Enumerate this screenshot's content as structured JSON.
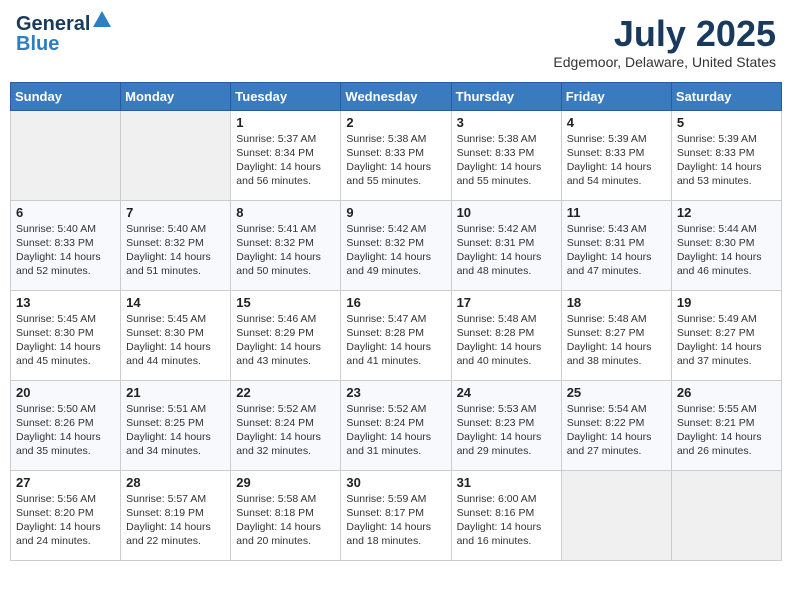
{
  "header": {
    "logo_general": "General",
    "logo_blue": "Blue",
    "title": "July 2025",
    "location": "Edgemoor, Delaware, United States"
  },
  "days_of_week": [
    "Sunday",
    "Monday",
    "Tuesday",
    "Wednesday",
    "Thursday",
    "Friday",
    "Saturday"
  ],
  "weeks": [
    [
      {
        "day": "",
        "detail": ""
      },
      {
        "day": "",
        "detail": ""
      },
      {
        "day": "1",
        "detail": "Sunrise: 5:37 AM\nSunset: 8:34 PM\nDaylight: 14 hours and 56 minutes."
      },
      {
        "day": "2",
        "detail": "Sunrise: 5:38 AM\nSunset: 8:33 PM\nDaylight: 14 hours and 55 minutes."
      },
      {
        "day": "3",
        "detail": "Sunrise: 5:38 AM\nSunset: 8:33 PM\nDaylight: 14 hours and 55 minutes."
      },
      {
        "day": "4",
        "detail": "Sunrise: 5:39 AM\nSunset: 8:33 PM\nDaylight: 14 hours and 54 minutes."
      },
      {
        "day": "5",
        "detail": "Sunrise: 5:39 AM\nSunset: 8:33 PM\nDaylight: 14 hours and 53 minutes."
      }
    ],
    [
      {
        "day": "6",
        "detail": "Sunrise: 5:40 AM\nSunset: 8:33 PM\nDaylight: 14 hours and 52 minutes."
      },
      {
        "day": "7",
        "detail": "Sunrise: 5:40 AM\nSunset: 8:32 PM\nDaylight: 14 hours and 51 minutes."
      },
      {
        "day": "8",
        "detail": "Sunrise: 5:41 AM\nSunset: 8:32 PM\nDaylight: 14 hours and 50 minutes."
      },
      {
        "day": "9",
        "detail": "Sunrise: 5:42 AM\nSunset: 8:32 PM\nDaylight: 14 hours and 49 minutes."
      },
      {
        "day": "10",
        "detail": "Sunrise: 5:42 AM\nSunset: 8:31 PM\nDaylight: 14 hours and 48 minutes."
      },
      {
        "day": "11",
        "detail": "Sunrise: 5:43 AM\nSunset: 8:31 PM\nDaylight: 14 hours and 47 minutes."
      },
      {
        "day": "12",
        "detail": "Sunrise: 5:44 AM\nSunset: 8:30 PM\nDaylight: 14 hours and 46 minutes."
      }
    ],
    [
      {
        "day": "13",
        "detail": "Sunrise: 5:45 AM\nSunset: 8:30 PM\nDaylight: 14 hours and 45 minutes."
      },
      {
        "day": "14",
        "detail": "Sunrise: 5:45 AM\nSunset: 8:30 PM\nDaylight: 14 hours and 44 minutes."
      },
      {
        "day": "15",
        "detail": "Sunrise: 5:46 AM\nSunset: 8:29 PM\nDaylight: 14 hours and 43 minutes."
      },
      {
        "day": "16",
        "detail": "Sunrise: 5:47 AM\nSunset: 8:28 PM\nDaylight: 14 hours and 41 minutes."
      },
      {
        "day": "17",
        "detail": "Sunrise: 5:48 AM\nSunset: 8:28 PM\nDaylight: 14 hours and 40 minutes."
      },
      {
        "day": "18",
        "detail": "Sunrise: 5:48 AM\nSunset: 8:27 PM\nDaylight: 14 hours and 38 minutes."
      },
      {
        "day": "19",
        "detail": "Sunrise: 5:49 AM\nSunset: 8:27 PM\nDaylight: 14 hours and 37 minutes."
      }
    ],
    [
      {
        "day": "20",
        "detail": "Sunrise: 5:50 AM\nSunset: 8:26 PM\nDaylight: 14 hours and 35 minutes."
      },
      {
        "day": "21",
        "detail": "Sunrise: 5:51 AM\nSunset: 8:25 PM\nDaylight: 14 hours and 34 minutes."
      },
      {
        "day": "22",
        "detail": "Sunrise: 5:52 AM\nSunset: 8:24 PM\nDaylight: 14 hours and 32 minutes."
      },
      {
        "day": "23",
        "detail": "Sunrise: 5:52 AM\nSunset: 8:24 PM\nDaylight: 14 hours and 31 minutes."
      },
      {
        "day": "24",
        "detail": "Sunrise: 5:53 AM\nSunset: 8:23 PM\nDaylight: 14 hours and 29 minutes."
      },
      {
        "day": "25",
        "detail": "Sunrise: 5:54 AM\nSunset: 8:22 PM\nDaylight: 14 hours and 27 minutes."
      },
      {
        "day": "26",
        "detail": "Sunrise: 5:55 AM\nSunset: 8:21 PM\nDaylight: 14 hours and 26 minutes."
      }
    ],
    [
      {
        "day": "27",
        "detail": "Sunrise: 5:56 AM\nSunset: 8:20 PM\nDaylight: 14 hours and 24 minutes."
      },
      {
        "day": "28",
        "detail": "Sunrise: 5:57 AM\nSunset: 8:19 PM\nDaylight: 14 hours and 22 minutes."
      },
      {
        "day": "29",
        "detail": "Sunrise: 5:58 AM\nSunset: 8:18 PM\nDaylight: 14 hours and 20 minutes."
      },
      {
        "day": "30",
        "detail": "Sunrise: 5:59 AM\nSunset: 8:17 PM\nDaylight: 14 hours and 18 minutes."
      },
      {
        "day": "31",
        "detail": "Sunrise: 6:00 AM\nSunset: 8:16 PM\nDaylight: 14 hours and 16 minutes."
      },
      {
        "day": "",
        "detail": ""
      },
      {
        "day": "",
        "detail": ""
      }
    ]
  ]
}
